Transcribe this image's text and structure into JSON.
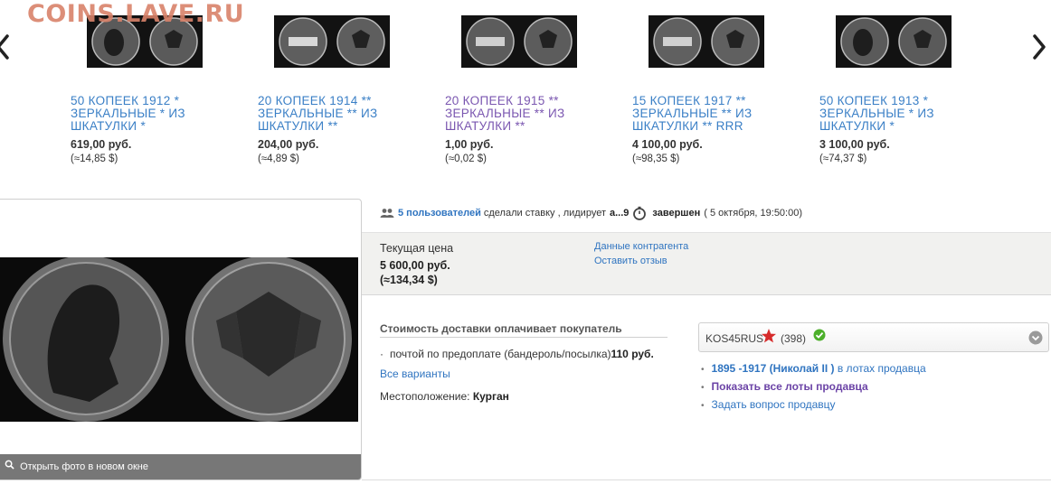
{
  "watermark": "COINS.LAVE.RU",
  "carousel": {
    "items": [
      {
        "title": "50 КОПЕЕК 1912 * ЗЕРКАЛЬНЫЕ * ИЗ ШКАТУЛКИ *",
        "price": "619,00 руб.",
        "usd": "(≈14,85 $)",
        "visited": false
      },
      {
        "title": "20 КОПЕЕК 1914 ** ЗЕРКАЛЬНЫЕ ** ИЗ ШКАТУЛКИ **",
        "price": "204,00 руб.",
        "usd": "(≈4,89 $)",
        "visited": false
      },
      {
        "title": "20 КОПЕЕК 1915 ** ЗЕРКАЛЬНЫЕ ** ИЗ ШКАТУЛКИ **",
        "price": "1,00 руб.",
        "usd": "(≈0,02 $)",
        "visited": true
      },
      {
        "title": "15 КОПЕЕК 1917 ** ЗЕРКАЛЬНЫЕ ** ИЗ ШКАТУЛКИ ** RRR",
        "price": "4 100,00 руб.",
        "usd": "(≈98,35 $)",
        "visited": false
      },
      {
        "title": "50 КОПЕЕК 1913 * ЗЕРКАЛЬНЫЕ * ИЗ ШКАТУЛКИ *",
        "price": "3 100,00 руб.",
        "usd": "(≈74,37 $)",
        "visited": false
      }
    ]
  },
  "photo": {
    "open_label": "Открыть фото в новом окне"
  },
  "bids": {
    "users_link": "5 пользователей",
    "made_bids": "сделали ставку , лидирует",
    "leader": "a...9",
    "status": "завершен",
    "ended_at": "( 5 октября, 19:50:00)"
  },
  "price": {
    "label": "Текущая цена",
    "rub": "5 600,00 руб.",
    "usd": "(≈134,34 $)",
    "seller_data_link": "Данные контрагента",
    "review_link": "Оставить отзыв"
  },
  "delivery": {
    "title": "Стоимость доставки оплачивает покупатель",
    "method": "почтой по предоплате (бандероль/посылка)",
    "cost": "110 руб.",
    "all_variants": "Все варианты",
    "location_label": "Местоположение:",
    "location_city": "Курган"
  },
  "seller": {
    "name": "KOS45RUS",
    "rating": "(398)",
    "lots_link": "1895 -1917 (Николай II )",
    "lots_suffix": "в лотах продавца",
    "all_lots": "Показать все лоты продавца",
    "ask": "Задать вопрос продавцу"
  },
  "colors": {
    "link": "#2f74c0",
    "visited": "#7a56b0",
    "star": "#d62b2b",
    "check": "#4caf2a"
  }
}
